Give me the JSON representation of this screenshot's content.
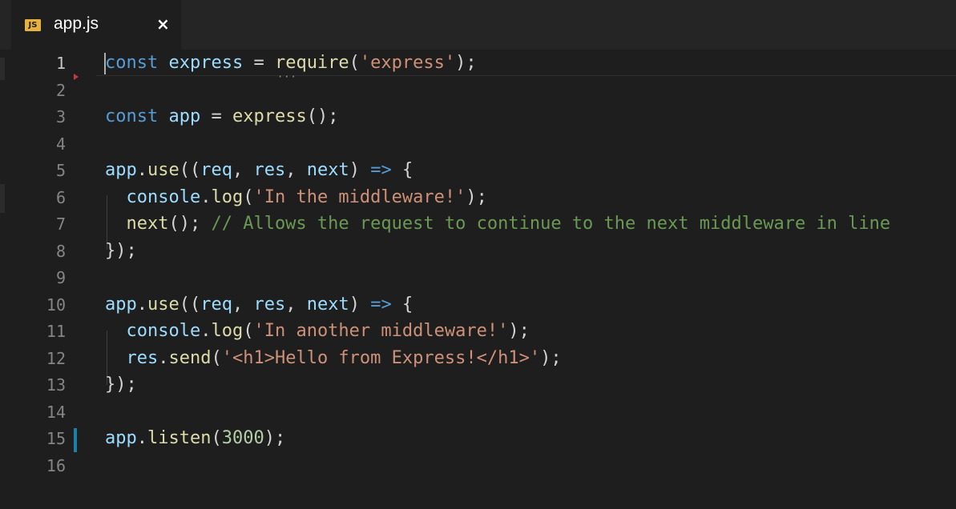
{
  "tab": {
    "icon_text": "JS",
    "filename": "app.js",
    "close_glyph": "×"
  },
  "editor": {
    "active_line": 1,
    "lines": [
      {
        "n": "1",
        "tokens": [
          [
            "kw",
            "const"
          ],
          [
            "pu",
            " "
          ],
          [
            "var",
            "express"
          ],
          [
            "pu",
            " = "
          ],
          [
            "fn",
            "require"
          ],
          [
            "pu",
            "("
          ],
          [
            "str",
            "'express'"
          ],
          [
            "pu",
            ");"
          ]
        ]
      },
      {
        "n": "2",
        "tokens": []
      },
      {
        "n": "3",
        "tokens": [
          [
            "kw",
            "const"
          ],
          [
            "pu",
            " "
          ],
          [
            "var",
            "app"
          ],
          [
            "pu",
            " = "
          ],
          [
            "fn",
            "express"
          ],
          [
            "pu",
            "();"
          ]
        ]
      },
      {
        "n": "4",
        "tokens": []
      },
      {
        "n": "5",
        "tokens": [
          [
            "var",
            "app"
          ],
          [
            "pu",
            "."
          ],
          [
            "fn",
            "use"
          ],
          [
            "pu",
            "(("
          ],
          [
            "var",
            "req"
          ],
          [
            "pu",
            ", "
          ],
          [
            "var",
            "res"
          ],
          [
            "pu",
            ", "
          ],
          [
            "var",
            "next"
          ],
          [
            "pu",
            ") "
          ],
          [
            "kw",
            "=>"
          ],
          [
            "pu",
            " {"
          ]
        ]
      },
      {
        "n": "6",
        "tokens": [
          [
            "pu",
            "  "
          ],
          [
            "var",
            "console"
          ],
          [
            "pu",
            "."
          ],
          [
            "fn",
            "log"
          ],
          [
            "pu",
            "("
          ],
          [
            "str",
            "'In the middleware!'"
          ],
          [
            "pu",
            ");"
          ]
        ]
      },
      {
        "n": "7",
        "tokens": [
          [
            "pu",
            "  "
          ],
          [
            "fn",
            "next"
          ],
          [
            "pu",
            "(); "
          ],
          [
            "cm",
            "// Allows the request to continue to the next middleware in line"
          ]
        ]
      },
      {
        "n": "8",
        "tokens": [
          [
            "pu",
            "});"
          ]
        ]
      },
      {
        "n": "9",
        "tokens": []
      },
      {
        "n": "10",
        "tokens": [
          [
            "var",
            "app"
          ],
          [
            "pu",
            "."
          ],
          [
            "fn",
            "use"
          ],
          [
            "pu",
            "(("
          ],
          [
            "var",
            "req"
          ],
          [
            "pu",
            ", "
          ],
          [
            "var",
            "res"
          ],
          [
            "pu",
            ", "
          ],
          [
            "var",
            "next"
          ],
          [
            "pu",
            ") "
          ],
          [
            "kw",
            "=>"
          ],
          [
            "pu",
            " {"
          ]
        ]
      },
      {
        "n": "11",
        "tokens": [
          [
            "pu",
            "  "
          ],
          [
            "var",
            "console"
          ],
          [
            "pu",
            "."
          ],
          [
            "fn",
            "log"
          ],
          [
            "pu",
            "("
          ],
          [
            "str",
            "'In another middleware!'"
          ],
          [
            "pu",
            ");"
          ]
        ]
      },
      {
        "n": "12",
        "tokens": [
          [
            "pu",
            "  "
          ],
          [
            "var",
            "res"
          ],
          [
            "pu",
            "."
          ],
          [
            "fn",
            "send"
          ],
          [
            "pu",
            "("
          ],
          [
            "str",
            "'<h1>Hello from Express!</h1>'"
          ],
          [
            "pu",
            ");"
          ]
        ]
      },
      {
        "n": "13",
        "tokens": [
          [
            "pu",
            "});"
          ]
        ]
      },
      {
        "n": "14",
        "tokens": []
      },
      {
        "n": "15",
        "tokens": [
          [
            "var",
            "app"
          ],
          [
            "pu",
            "."
          ],
          [
            "fn",
            "listen"
          ],
          [
            "pu",
            "("
          ],
          [
            "num",
            "3000"
          ],
          [
            "pu",
            ");"
          ]
        ]
      },
      {
        "n": "16",
        "tokens": []
      }
    ]
  },
  "colors": {
    "background": "#1e1e1e",
    "keyword": "#569cd6",
    "variable": "#9cdcfe",
    "function": "#dcdcaa",
    "string": "#ce9178",
    "comment": "#6a9955",
    "number": "#b5cea8",
    "git_modified": "#1b81a8"
  }
}
